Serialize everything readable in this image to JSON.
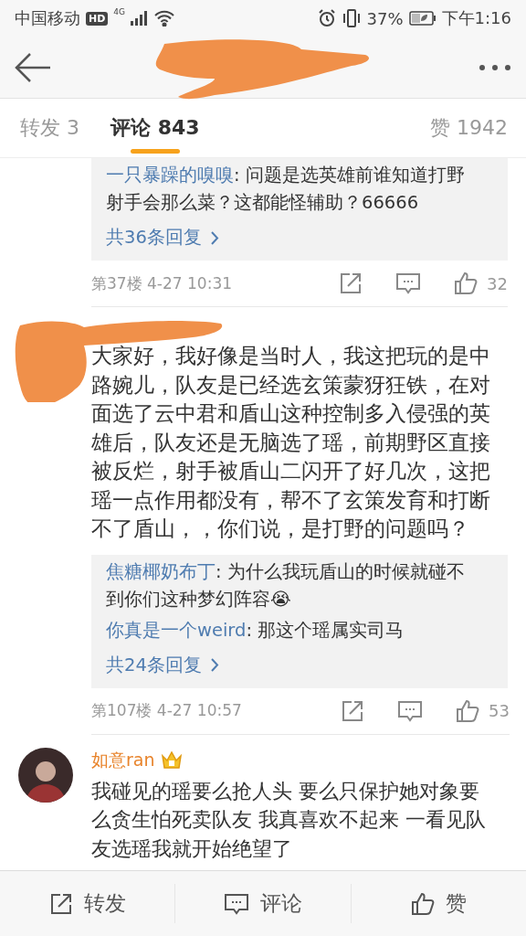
{
  "status_bar": {
    "carrier": "中国移动",
    "hd": "HD",
    "network": "4G",
    "battery": "37%",
    "time": "下午1:16"
  },
  "tabs": [
    {
      "label": "转发 3",
      "selected": false
    },
    {
      "label": "评论 843",
      "selected": true
    },
    {
      "label": "赞 1942",
      "selected": false
    }
  ],
  "comments": [
    {
      "replies": [
        {
          "user": "一只暴躁的嗅嗅",
          "text": ": 问题是选英雄前谁知道打野射手会那么菜？这都能怪辅助？66666"
        }
      ],
      "more_replies": "共36条回复",
      "floor_time": "第37楼 4-27 10:31",
      "likes": "32"
    },
    {
      "text": "大家好，我好像是当时人，我这把玩的是中路婉儿，队友是已经选玄策蒙犽狂铁，在对面选了云中君和盾山这种控制多入侵强的英雄后，队友还是无脑选了瑶，前期野区直接被反烂，射手被盾山二闪开了好几次，这把瑶一点作用都没有，帮不了玄策发育和打断不了盾山，，你们说，是打野的问题吗？",
      "replies": [
        {
          "user": "焦糖椰奶布丁",
          "text": ": 为什么我玩盾山的时候就碰不到你们这种梦幻阵容😭"
        },
        {
          "user": "你真是一个weird",
          "text": ": 那这个瑶属实司马"
        }
      ],
      "more_replies": "共24条回复",
      "floor_time": "第107楼 4-27 10:57",
      "likes": "53"
    },
    {
      "user": "如意ran",
      "text": "我碰见的瑶要么抢人头 要么只保护她对象要么贪生怕死卖队友 我真喜欢不起来 一看见队友选瑶我就开始绝望了"
    }
  ],
  "bottom_bar": [
    {
      "label": "转发",
      "kind": "share"
    },
    {
      "label": "评论",
      "kind": "comment"
    },
    {
      "label": "赞",
      "kind": "like"
    }
  ]
}
